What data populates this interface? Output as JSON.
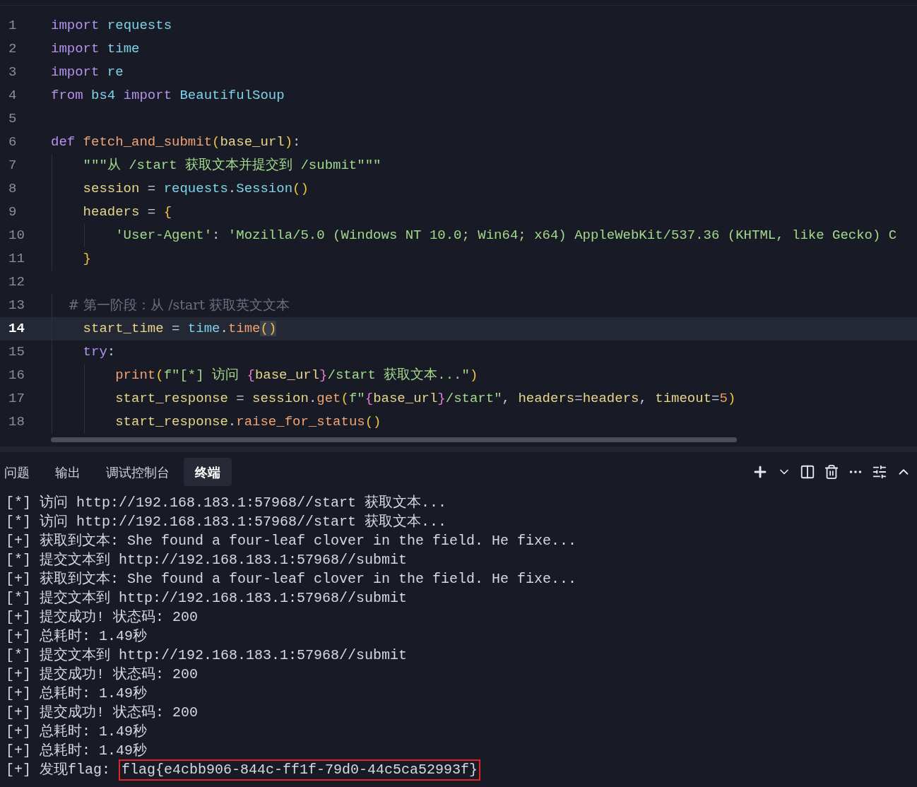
{
  "editor": {
    "lines": [
      {
        "number": "1",
        "current": false,
        "tokens": [
          {
            "kind": "keyword",
            "text": "import"
          },
          {
            "kind": "module",
            "text": " requests"
          }
        ]
      },
      {
        "number": "2",
        "current": false,
        "tokens": [
          {
            "kind": "keyword",
            "text": "import"
          },
          {
            "kind": "module",
            "text": " time"
          }
        ]
      },
      {
        "number": "3",
        "current": false,
        "tokens": [
          {
            "kind": "keyword",
            "text": "import"
          },
          {
            "kind": "module",
            "text": " re"
          }
        ]
      },
      {
        "number": "4",
        "current": false,
        "tokens": [
          {
            "kind": "keyword",
            "text": "from"
          },
          {
            "kind": "module",
            "text": " bs4"
          },
          {
            "kind": "keyword",
            "text": " import"
          },
          {
            "kind": "module",
            "text": " BeautifulSoup"
          }
        ]
      },
      {
        "number": "5",
        "current": false
      },
      {
        "number": "6",
        "current": false,
        "tokens": [
          {
            "kind": "keyword",
            "text": "def"
          },
          {
            "kind": "func",
            "text": " fetch_and_submit"
          },
          {
            "kind": "paren",
            "text": "("
          },
          {
            "kind": "param",
            "text": "base_url"
          },
          {
            "kind": "paren",
            "text": ")"
          },
          {
            "kind": "plain",
            "text": ":"
          }
        ]
      },
      {
        "number": "7",
        "current": false,
        "tokens": [
          {
            "kind": "string",
            "text": "    \"\"\"从 /start 获取文本并提交到 /submit\"\"\""
          }
        ]
      },
      {
        "number": "8",
        "current": false,
        "tokens": [
          {
            "kind": "param",
            "text": "    session"
          },
          {
            "kind": "plain",
            "text": " = "
          },
          {
            "kind": "module",
            "text": "requests"
          },
          {
            "kind": "plain",
            "text": "."
          },
          {
            "kind": "module",
            "text": "Session"
          },
          {
            "kind": "paren",
            "text": "()"
          }
        ]
      },
      {
        "number": "9",
        "current": false,
        "tokens": [
          {
            "kind": "param",
            "text": "    headers"
          },
          {
            "kind": "plain",
            "text": " = "
          },
          {
            "kind": "paren",
            "text": "{"
          }
        ]
      },
      {
        "number": "10",
        "current": false,
        "tokens": [
          {
            "kind": "string",
            "text": "        'User-Agent'"
          },
          {
            "kind": "plain",
            "text": ":"
          },
          {
            "kind": "string",
            "text": " 'Mozilla/5.0 (Windows NT 10.0; Win64; x64) AppleWebKit/537.36 (KHTML, like Gecko) C"
          }
        ]
      },
      {
        "number": "11",
        "current": false,
        "tokens": [
          {
            "kind": "paren",
            "text": "    }"
          }
        ]
      },
      {
        "number": "12",
        "current": false
      },
      {
        "number": "13",
        "current": false,
        "tokens": [
          {
            "kind": "comment",
            "text": "    # 第一阶段：从 /start 获取英文文本"
          }
        ]
      },
      {
        "number": "14",
        "current": true,
        "tokens": [
          {
            "kind": "param",
            "text": "    start_time"
          },
          {
            "kind": "plain",
            "text": " = "
          },
          {
            "kind": "module",
            "text": "time"
          },
          {
            "kind": "plain",
            "text": "."
          },
          {
            "kind": "func",
            "text": "time"
          },
          {
            "kind": "match",
            "text": "()"
          }
        ]
      },
      {
        "number": "15",
        "current": false,
        "tokens": [
          {
            "kind": "keyword",
            "text": "    try"
          },
          {
            "kind": "plain",
            "text": ":"
          }
        ]
      },
      {
        "number": "16",
        "current": false,
        "tokens": [
          {
            "kind": "func",
            "text": "        print"
          },
          {
            "kind": "paren",
            "text": "("
          },
          {
            "kind": "string",
            "text": "f\"[*] 访问 "
          },
          {
            "kind": "brace",
            "text": "{"
          },
          {
            "kind": "param",
            "text": "base_url"
          },
          {
            "kind": "brace",
            "text": "}"
          },
          {
            "kind": "string",
            "text": "/start 获取文本...\""
          },
          {
            "kind": "paren",
            "text": ")"
          }
        ]
      },
      {
        "number": "17",
        "current": false,
        "tokens": [
          {
            "kind": "param",
            "text": "        start_response"
          },
          {
            "kind": "plain",
            "text": " = "
          },
          {
            "kind": "param",
            "text": "session"
          },
          {
            "kind": "plain",
            "text": "."
          },
          {
            "kind": "func",
            "text": "get"
          },
          {
            "kind": "paren",
            "text": "("
          },
          {
            "kind": "string",
            "text": "f\""
          },
          {
            "kind": "brace",
            "text": "{"
          },
          {
            "kind": "param",
            "text": "base_url"
          },
          {
            "kind": "brace",
            "text": "}"
          },
          {
            "kind": "string",
            "text": "/start\""
          },
          {
            "kind": "plain",
            "text": ","
          },
          {
            "kind": "param",
            "text": " headers"
          },
          {
            "kind": "plain",
            "text": "="
          },
          {
            "kind": "param",
            "text": "headers"
          },
          {
            "kind": "plain",
            "text": ","
          },
          {
            "kind": "param",
            "text": " timeout"
          },
          {
            "kind": "plain",
            "text": "="
          },
          {
            "kind": "number",
            "text": "5"
          },
          {
            "kind": "paren",
            "text": ")"
          }
        ]
      },
      {
        "number": "18",
        "current": false,
        "tokens": [
          {
            "kind": "param",
            "text": "        start_response"
          },
          {
            "kind": "plain",
            "text": "."
          },
          {
            "kind": "func",
            "text": "raise_for_status"
          },
          {
            "kind": "paren",
            "text": "()"
          }
        ]
      }
    ]
  },
  "panel": {
    "tabs": [
      {
        "label": "问题",
        "selected": false
      },
      {
        "label": "输出",
        "selected": false
      },
      {
        "label": "调试控制台",
        "selected": false
      },
      {
        "label": "终端",
        "selected": true
      }
    ],
    "terminal": [
      {
        "kind": "plain",
        "text": "[*] 访问 http://192.168.183.1:57968//start 获取文本..."
      },
      {
        "kind": "plain",
        "text": "[*] 访问 http://192.168.183.1:57968//start 获取文本..."
      },
      {
        "kind": "plain",
        "text": "[+] 获取到文本: She found a four-leaf clover in the field. He fixe..."
      },
      {
        "kind": "plain",
        "text": "[*] 提交文本到 http://192.168.183.1:57968//submit"
      },
      {
        "kind": "plain",
        "text": "[+] 获取到文本: She found a four-leaf clover in the field. He fixe..."
      },
      {
        "kind": "plain",
        "text": "[*] 提交文本到 http://192.168.183.1:57968//submit"
      },
      {
        "kind": "plain",
        "text": "[+] 提交成功! 状态码: 200"
      },
      {
        "kind": "plain",
        "text": "[+] 总耗时: 1.49秒"
      },
      {
        "kind": "plain",
        "text": "[*] 提交文本到 http://192.168.183.1:57968//submit"
      },
      {
        "kind": "plain",
        "text": "[+] 提交成功! 状态码: 200"
      },
      {
        "kind": "plain",
        "text": "[+] 总耗时: 1.49秒"
      },
      {
        "kind": "plain",
        "text": "[+] 提交成功! 状态码: 200"
      },
      {
        "kind": "plain",
        "text": "[+] 总耗时: 1.49秒"
      },
      {
        "kind": "plain",
        "text": "[+] 总耗时: 1.49秒"
      },
      {
        "kind": "flag",
        "text": "[+] 发现flag:",
        "value": "flag{e4cbb906-844c-ff1f-79d0-44c5ca52993f}"
      }
    ]
  }
}
